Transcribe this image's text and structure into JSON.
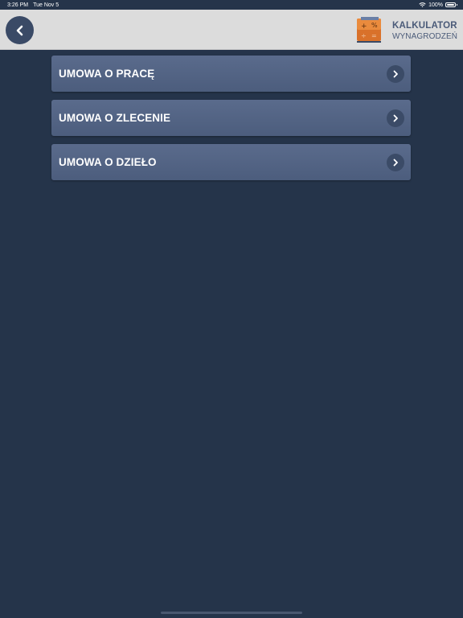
{
  "status_bar": {
    "time": "3:26 PM",
    "date": "Tue Nov 5",
    "battery": "100%",
    "wifi_icon": "wifi-icon",
    "battery_icon": "battery-icon"
  },
  "nav": {
    "back_icon": "chevron-left-icon",
    "logo_icon": "calculator-icon",
    "logo_line1": "KALKULATOR",
    "logo_line2": "WYNAGRODZEŃ"
  },
  "menu": {
    "items": [
      {
        "label": "UMOWA O PRACĘ",
        "icon": "chevron-right-icon"
      },
      {
        "label": "UMOWA O ZLECENIE",
        "icon": "chevron-right-icon"
      },
      {
        "label": "UMOWA O DZIEŁO",
        "icon": "chevron-right-icon"
      }
    ]
  },
  "colors": {
    "background": "#25344a",
    "nav_background": "#dcdcdc",
    "menu_item": "#53648a",
    "logo_text": "#4a5a78",
    "logo_orange": "#e07a2a"
  }
}
